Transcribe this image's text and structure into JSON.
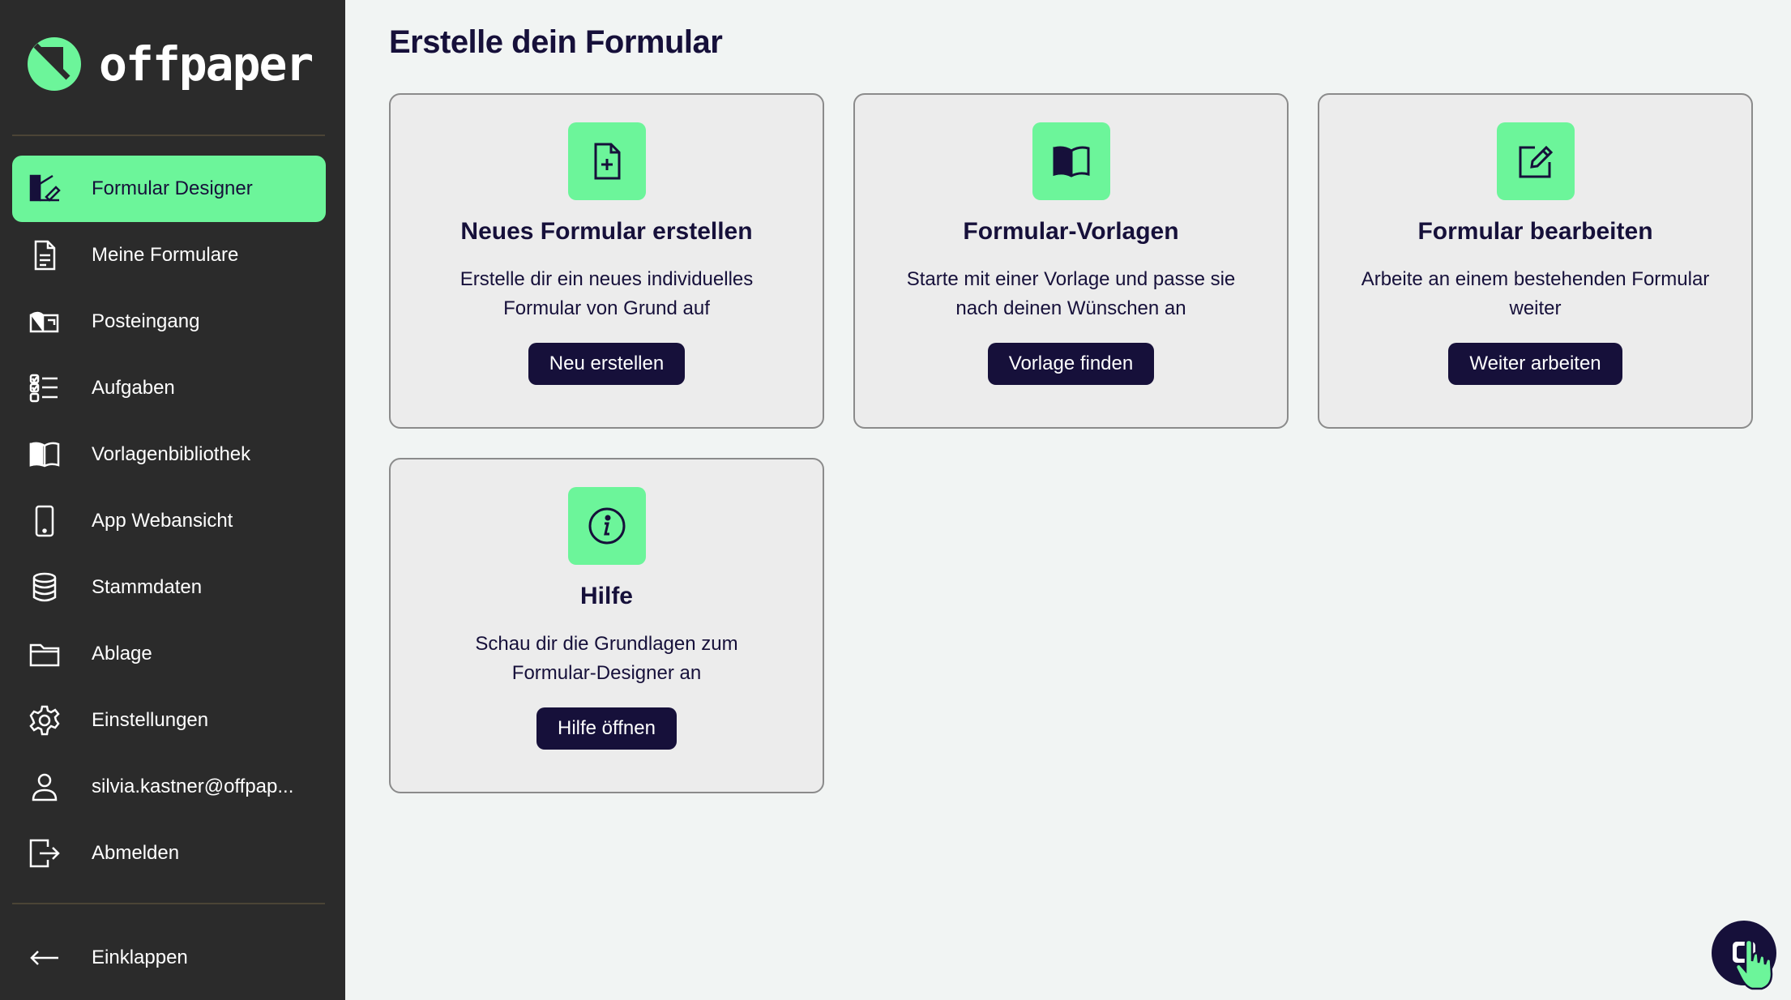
{
  "app": {
    "name": "offpaper",
    "accent": "#6cf59a",
    "dark": "#16103a",
    "sidebar_bg": "#2b2b2b"
  },
  "sidebar": {
    "items": [
      {
        "label": "Formular Designer",
        "icon": "form-designer-icon",
        "active": true
      },
      {
        "label": "Meine Formulare",
        "icon": "document-icon"
      },
      {
        "label": "Posteingang",
        "icon": "inbox-icon"
      },
      {
        "label": "Aufgaben",
        "icon": "tasks-icon"
      },
      {
        "label": "Vorlagenbibliothek",
        "icon": "book-icon"
      },
      {
        "label": "App Webansicht",
        "icon": "phone-icon"
      },
      {
        "label": "Stammdaten",
        "icon": "database-icon"
      },
      {
        "label": "Ablage",
        "icon": "folder-icon"
      },
      {
        "label": "Einstellungen",
        "icon": "gear-icon"
      },
      {
        "label": "silvia.kastner@offpap...",
        "icon": "user-icon"
      },
      {
        "label": "Abmelden",
        "icon": "logout-icon"
      }
    ],
    "collapse_label": "Einklappen"
  },
  "main": {
    "title": "Erstelle dein Formular",
    "cards": [
      {
        "title": "Neues Formular erstellen",
        "line1": "Erstelle dir ein neues individuelles",
        "line2": "Formular von Grund auf",
        "button": "Neu erstellen",
        "icon": "file-plus-icon"
      },
      {
        "title": "Formular-Vorlagen",
        "line1": "Starte mit einer Vorlage und passe sie",
        "line2": "nach deinen Wünschen an",
        "button": "Vorlage finden",
        "icon": "open-book-icon"
      },
      {
        "title": "Formular bearbeiten",
        "line1": "Arbeite an einem bestehenden Formular",
        "line2": "weiter",
        "button": "Weiter arbeiten",
        "icon": "edit-icon"
      },
      {
        "title": "Hilfe",
        "line1": "Schau dir die Grundlagen zum",
        "line2": "Formular-Designer an",
        "button": "Hilfe öffnen",
        "icon": "info-icon"
      }
    ]
  }
}
